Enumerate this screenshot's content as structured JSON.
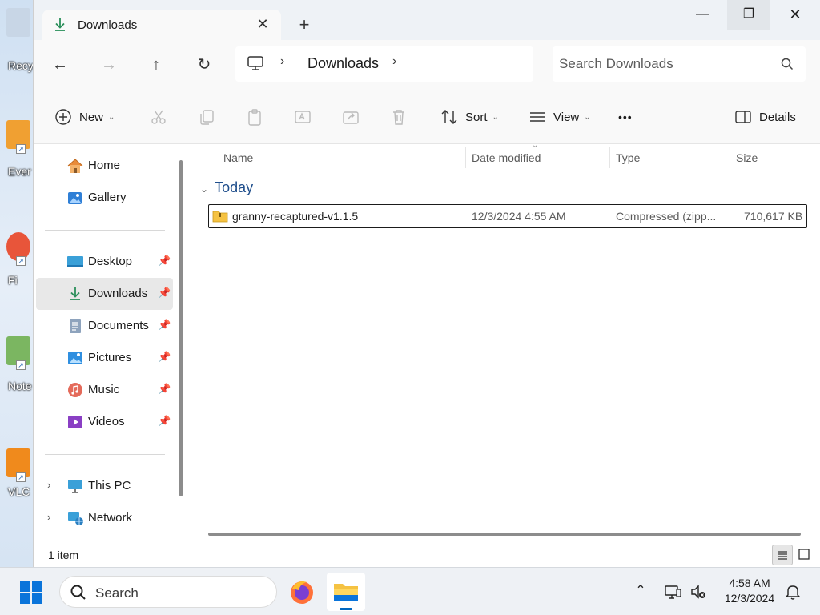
{
  "desktop": {
    "icons": [
      {
        "label": "Recy"
      },
      {
        "label": "Ever"
      },
      {
        "label": "Fi"
      },
      {
        "label": "Note"
      },
      {
        "label": "VLC"
      }
    ]
  },
  "window": {
    "tab_title": "Downloads",
    "tab_close": "✕",
    "new_tab": "+",
    "controls": {
      "minimize": "—",
      "maximize": "❐",
      "close": "✕"
    }
  },
  "address": {
    "breadcrumb": "Downloads",
    "search_placeholder": "Search Downloads"
  },
  "toolbar": {
    "new_label": "New",
    "sort_label": "Sort",
    "view_label": "View",
    "more_label": "•••",
    "details_label": "Details"
  },
  "nav": {
    "home": "Home",
    "gallery": "Gallery",
    "quick_access": [
      {
        "label": "Desktop",
        "pinned": true
      },
      {
        "label": "Downloads",
        "pinned": true,
        "selected": true
      },
      {
        "label": "Documents",
        "pinned": true
      },
      {
        "label": "Pictures",
        "pinned": true
      },
      {
        "label": "Music",
        "pinned": true
      },
      {
        "label": "Videos",
        "pinned": true
      }
    ],
    "this_pc": "This PC",
    "network": "Network"
  },
  "columns": {
    "name": "Name",
    "date_modified": "Date modified",
    "type": "Type",
    "size": "Size"
  },
  "group": {
    "label": "Today"
  },
  "files": [
    {
      "name": "granny-recaptured-v1.1.5",
      "date_modified": "12/3/2024 4:55 AM",
      "type": "Compressed (zipp...",
      "size": "710,617 KB"
    }
  ],
  "status": {
    "item_count": "1 item"
  },
  "taskbar": {
    "search_label": "Search",
    "time": "4:58 AM",
    "date": "12/3/2024"
  },
  "colors": {
    "accent": "#0067c0",
    "folder": "#f5c242"
  }
}
